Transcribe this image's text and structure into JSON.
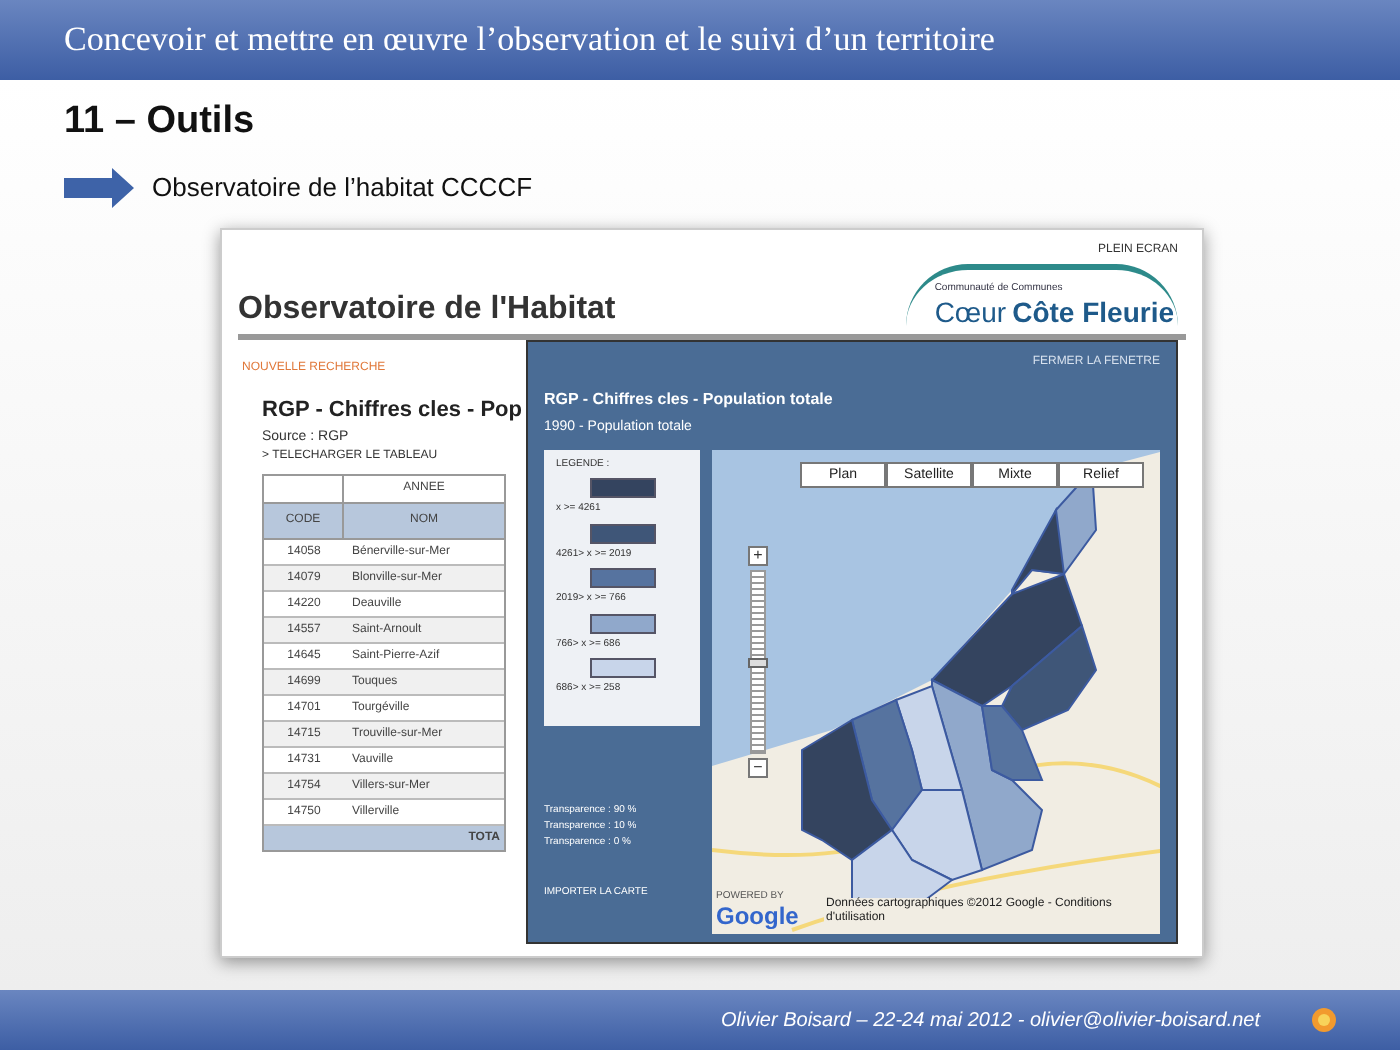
{
  "header": {
    "title": "Concevoir et mettre en œuvre l’observation et le suivi d’un territoire"
  },
  "section_title": "11 – Outils",
  "bullet": "Observatoire de l’habitat CCCCF",
  "screenshot": {
    "full_screen": "PLEIN ECRAN",
    "logo": {
      "line1": "Communauté de Communes",
      "line2": "Cœur",
      "line3": "Côte Fleurie"
    },
    "page_title": "Observatoire de l'Habitat",
    "new_search": "NOUVELLE RECHERCHE",
    "table_title": "RGP - Chiffres cles - Pop",
    "source": "Source : RGP",
    "download": "> TELECHARGER LE TABLEAU",
    "table": {
      "group_header": "ANNEE",
      "columns": [
        "CODE",
        "NOM"
      ],
      "rows": [
        [
          "14058",
          "Bénerville-sur-Mer"
        ],
        [
          "14079",
          "Blonville-sur-Mer"
        ],
        [
          "14220",
          "Deauville"
        ],
        [
          "14557",
          "Saint-Arnoult"
        ],
        [
          "14645",
          "Saint-Pierre-Azif"
        ],
        [
          "14699",
          "Touques"
        ],
        [
          "14701",
          "Tourgéville"
        ],
        [
          "14715",
          "Trouville-sur-Mer"
        ],
        [
          "14731",
          "Vauville"
        ],
        [
          "14754",
          "Villers-sur-Mer"
        ],
        [
          "14750",
          "Villerville"
        ]
      ],
      "total": "TOTA"
    },
    "popup": {
      "close": "FERMER LA FENETRE",
      "title": "RGP - Chiffres cles - Population totale",
      "subtitle": "1990 - Population totale",
      "legend_title": "LEGENDE :",
      "legend": [
        {
          "label": "x >= 4261",
          "color": "#34445f"
        },
        {
          "label": "4261> x >= 2019",
          "color": "#3f5678"
        },
        {
          "label": "2019> x >= 766",
          "color": "#56739f"
        },
        {
          "label": "766> x >= 686",
          "color": "#90a8cb"
        },
        {
          "label": "686> x >= 258",
          "color": "#c8d5ea"
        }
      ],
      "transparency": [
        "Transparence : 90 %",
        "Transparence : 10 %",
        "Transparence : 0 %"
      ],
      "import": "IMPORTER LA CARTE",
      "map": {
        "buttons": [
          "Plan",
          "Satellite",
          "Mixte",
          "Relief"
        ],
        "zoom_in": "+",
        "zoom": {
          "level": 0.5
        },
        "zoom_out": "−",
        "powered": "POWERED BY",
        "logo": "Google",
        "copyright": "Données cartographiques ©2012 Google - Conditions d'utilisation"
      }
    }
  },
  "footer": "Olivier Boisard – 22-24 mai 2012 - olivier@olivier-boisard.net"
}
